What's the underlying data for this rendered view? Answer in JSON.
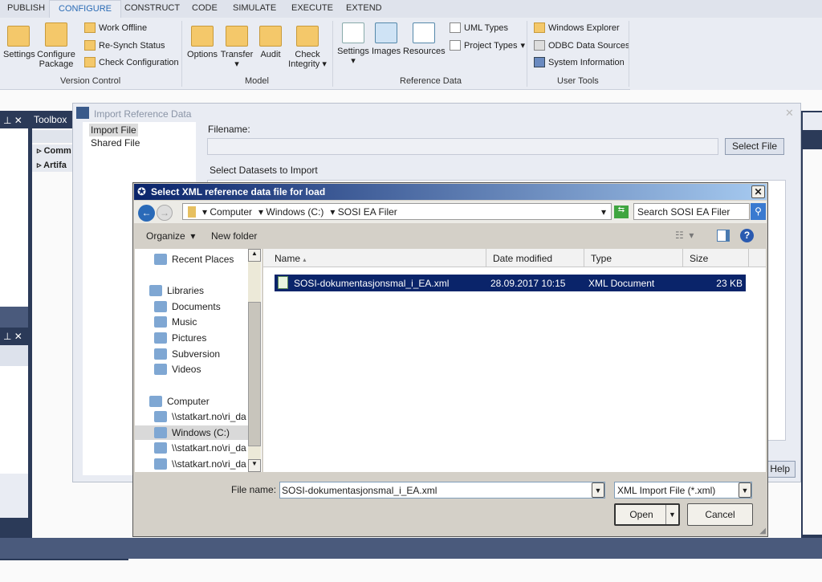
{
  "ribbon": {
    "tabs": [
      "PUBLISH",
      "CONFIGURE",
      "CONSTRUCT",
      "CODE",
      "SIMULATE",
      "EXECUTE",
      "EXTEND"
    ],
    "active_tab": "CONFIGURE",
    "version_control": {
      "label": "Version Control",
      "settings": "Settings",
      "configure_package": [
        "Configure",
        "Package"
      ],
      "work_offline": "Work Offline",
      "resynch": "Re-Synch Status",
      "check_config": "Check Configuration"
    },
    "model": {
      "label": "Model",
      "options": "Options",
      "transfer": "Transfer",
      "audit": "Audit",
      "check_integrity": [
        "Check",
        "Integrity"
      ]
    },
    "reference_data": {
      "label": "Reference Data",
      "settings": "Settings",
      "images": "Images",
      "resources": "Resources",
      "uml_types": "UML Types",
      "project_types": "Project Types"
    },
    "user_tools": {
      "label": "User Tools",
      "windows_explorer": "Windows Explorer",
      "odbc": "ODBC Data Sources",
      "system_info": "System Information"
    }
  },
  "panels": {
    "toolbox": {
      "title": "Toolbox",
      "col": "M",
      "items": [
        "Comm",
        "Artifa"
      ]
    }
  },
  "import_dialog": {
    "title": "Import Reference Data",
    "tree": [
      "Import File",
      "Shared File"
    ],
    "filename_label": "Filename:",
    "filename_value": "",
    "select_file": "Select File",
    "datasets_label": "Select Datasets to Import",
    "help": "Help"
  },
  "file_dialog": {
    "title": "Select XML reference data file for load",
    "breadcrumb": [
      "Computer",
      "Windows (C:)",
      "SOSI EA Filer"
    ],
    "search_placeholder": "Search SOSI EA Filer",
    "organize": "Organize",
    "new_folder": "New folder",
    "nav": [
      {
        "label": "Recent Places",
        "indent": true
      },
      {
        "label": "Libraries",
        "indent": false
      },
      {
        "label": "Documents",
        "indent": true
      },
      {
        "label": "Music",
        "indent": true
      },
      {
        "label": "Pictures",
        "indent": true
      },
      {
        "label": "Subversion",
        "indent": true
      },
      {
        "label": "Videos",
        "indent": true
      },
      {
        "label": "Computer",
        "indent": false
      },
      {
        "label": "\\\\statkart.no\\ri_da",
        "indent": true
      },
      {
        "label": "Windows (C:)",
        "indent": true,
        "selected": true
      },
      {
        "label": "\\\\statkart.no\\ri_da",
        "indent": true
      },
      {
        "label": "\\\\statkart.no\\ri_da",
        "indent": true
      }
    ],
    "columns": [
      "Name",
      "Date modified",
      "Type",
      "Size"
    ],
    "files": [
      {
        "name": "SOSI-dokumentasjonsmal_i_EA.xml",
        "date": "28.09.2017 10:15",
        "type": "XML Document",
        "size": "23 KB",
        "selected": true
      }
    ],
    "file_name_label": "File name:",
    "file_name_value": "SOSI-dokumentasjonsmal_i_EA.xml",
    "filter": "XML Import File (*.xml)",
    "open": "Open",
    "cancel": "Cancel"
  },
  "colors": {
    "selection": "#0a246a",
    "accent": "#2a6bb5",
    "navy": "#2b3a58"
  }
}
